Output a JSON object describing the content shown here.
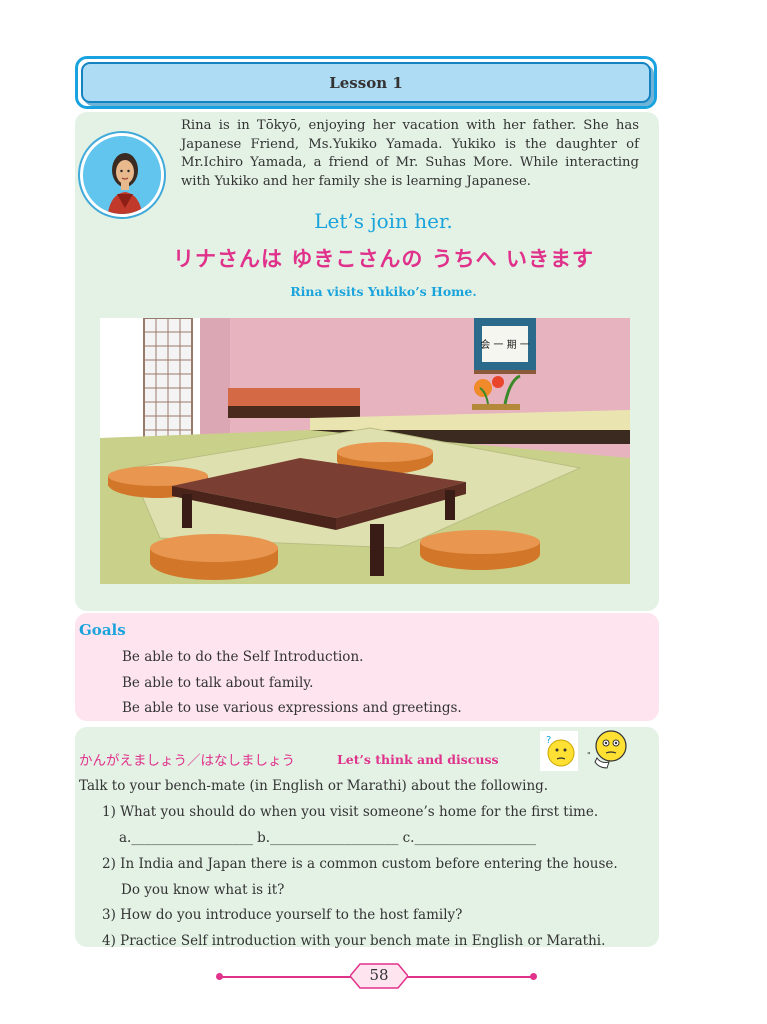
{
  "lesson": {
    "title": "Lesson 1"
  },
  "intro": {
    "text": "Rina is in Tōkyō, enjoying her vacation with her father. She has Japanese Friend, Ms.Yukiko Yamada. Yukiko is the daughter of Mr.Ichiro Yamada, a friend of Mr. Suhas More. While interacting with Yukiko and her family she is learning Japanese.",
    "join_heading": "Let’s join her.",
    "jp_title": "リナさんは ゆきこさんの うちへ いきます",
    "subtitle": "Rina visits Yukiko’s Home.",
    "scroll_text": "会 一 期 一"
  },
  "goals": {
    "title": "Goals",
    "items": [
      "Be able to do the Self Introduction.",
      "Be able to talk about family.",
      "Be able to use various expressions and greetings."
    ]
  },
  "discuss": {
    "heading_jp": "かんがえましょう／はなしましょう",
    "heading_en": "Let’s think and discuss",
    "instruction": "Talk to your bench-mate (in English or Marathi) about the following.",
    "q1": "1)  What you should do when you visit someone’s home for the first time.",
    "q1_blanks": "a.__________________ b.___________________ c.__________________",
    "q2": "2)  In India and Japan there is a common custom before entering the house.",
    "q2_follow": "Do you know what is it?",
    "q3": "3)  How do you introduce yourself to the host family?",
    "q4": "4)  Practice Self introduction with your bench mate in English or Marathi."
  },
  "footer": {
    "page_number": "58"
  },
  "colors": {
    "accent_blue": "#1ba4dc",
    "accent_pink": "#e0318b",
    "panel_green": "#e4f2e6",
    "panel_pink": "#fde4ee"
  }
}
